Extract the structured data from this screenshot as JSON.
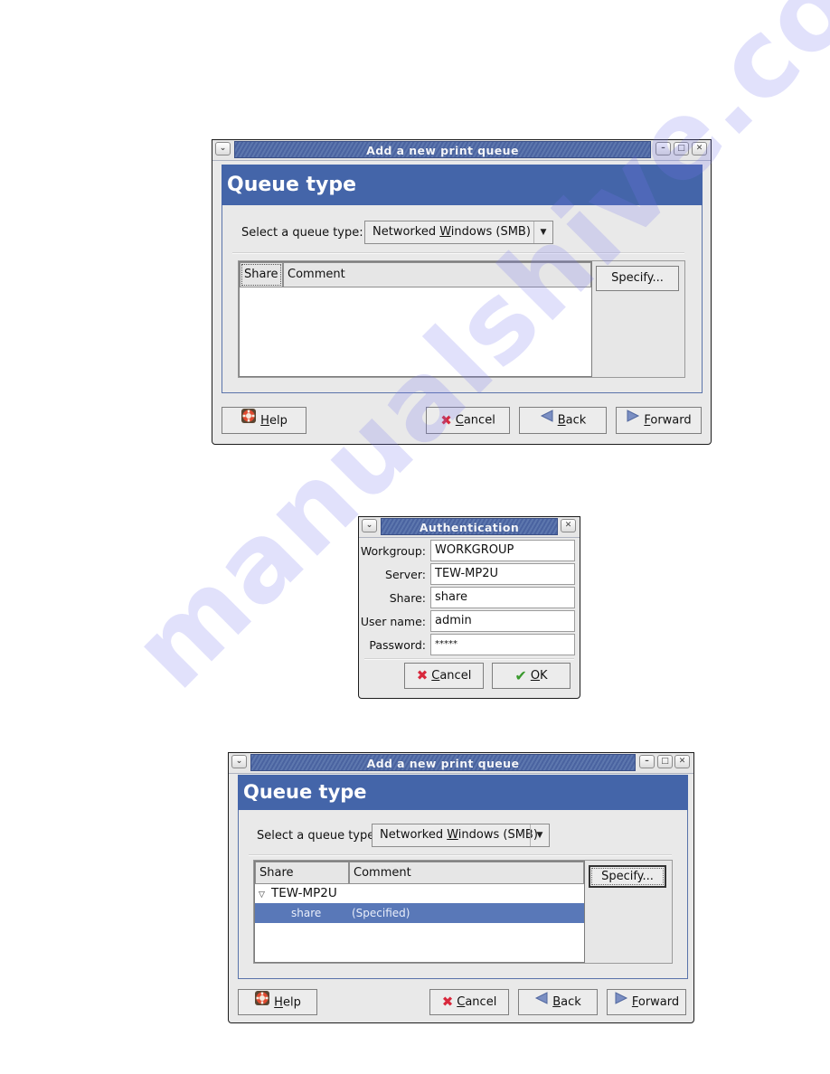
{
  "dialog1": {
    "title": "Add a new print queue",
    "banner": "Queue type",
    "queue_type_label": "Select a queue type:",
    "queue_type_value": "Networked Windows (SMB)",
    "queue_type_mnemonic_pre": "Networked ",
    "queue_type_mnemonic_char": "W",
    "queue_type_mnemonic_post": "indows (SMB)",
    "columns": [
      "Share",
      "Comment"
    ],
    "rows": [],
    "specify_button": "Specify...",
    "buttons": {
      "help": {
        "mnemonic": "H",
        "rest": "elp"
      },
      "cancel": {
        "mnemonic": "C",
        "rest": "ancel"
      },
      "back": {
        "mnemonic": "B",
        "rest": "ack"
      },
      "forward": {
        "mnemonic": "F",
        "rest": "orward"
      }
    }
  },
  "auth": {
    "title": "Authentication",
    "fields": [
      {
        "label": "Workgroup:",
        "value": "WORKGROUP"
      },
      {
        "label": "Server:",
        "value": "TEW-MP2U"
      },
      {
        "label": "Share:",
        "value": "share"
      },
      {
        "label": "User name:",
        "value": "admin"
      },
      {
        "label": "Password:",
        "value": "*****"
      }
    ],
    "buttons": {
      "cancel": {
        "mnemonic": "C",
        "rest": "ancel"
      },
      "ok": {
        "mnemonic": "O",
        "rest": "K"
      }
    }
  },
  "dialog2": {
    "title": "Add a new print queue",
    "banner": "Queue type",
    "queue_type_label": "Select a queue type:",
    "queue_type_mnemonic_pre": "Networked ",
    "queue_type_mnemonic_char": "W",
    "queue_type_mnemonic_post": "indows (SMB)",
    "columns": [
      "Share",
      "Comment"
    ],
    "tree": {
      "server": "TEW-MP2U",
      "expanded": true,
      "children": [
        {
          "share": "share",
          "comment": "(Specified)",
          "selected": true
        }
      ]
    },
    "specify_button": "Specify...",
    "buttons": {
      "help": {
        "mnemonic": "H",
        "rest": "elp"
      },
      "cancel": {
        "mnemonic": "C",
        "rest": "ancel"
      },
      "back": {
        "mnemonic": "B",
        "rest": "ack"
      },
      "forward": {
        "mnemonic": "F",
        "rest": "orward"
      }
    }
  },
  "watermark": "manualshive.com",
  "colors": {
    "banner": "#4465a9",
    "selection": "#5978b8",
    "titlebar": "#4a63a0"
  }
}
